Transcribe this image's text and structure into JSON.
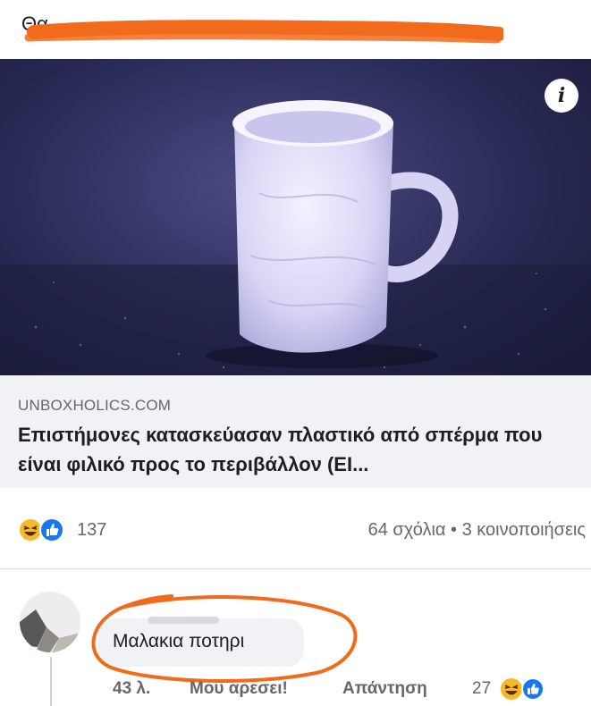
{
  "caption": {
    "text": "Θα",
    "scribble_color": "#f26a1b"
  },
  "article": {
    "info_label": "i",
    "domain": "UNBOXHOLICS.COM",
    "title": "Επιστήμονες κατασκεύασαν πλαστικό από σπέρμα που είναι φιλικό προς το περιβάλλον (ΕΙ..."
  },
  "reactions": {
    "icons": [
      "haha-icon",
      "like-icon"
    ],
    "count": "137",
    "comments": "64 σχόλια",
    "separator": "•",
    "shares": "3 κοινοποιήσεις"
  },
  "comment": {
    "text": "Μαλακια ποτηρι",
    "time": "43 λ.",
    "like_label": "Μου αρεσει!",
    "reply_label": "Απάντηση",
    "reaction_count": "27",
    "reaction_icons": [
      "haha-icon",
      "like-icon"
    ],
    "highlight_color": "#f26a1b"
  },
  "colors": {
    "link_background": "#f0f2f5",
    "secondary_text": "#65676b",
    "like_blue": "#1877f2",
    "haha_yellow": "#f7b928"
  }
}
